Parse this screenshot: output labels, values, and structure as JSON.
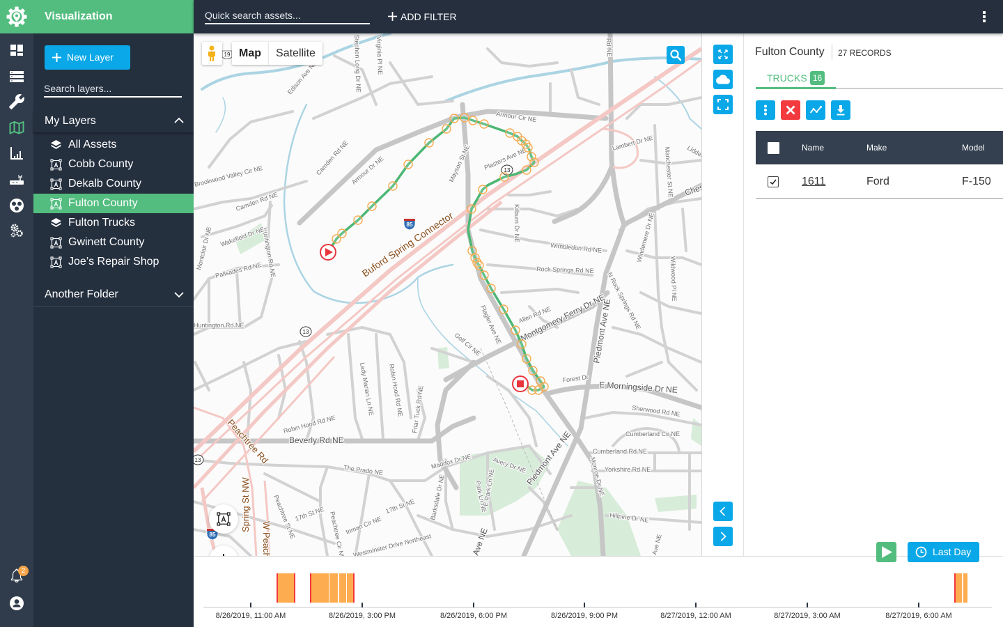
{
  "app": {
    "title": "Visualization",
    "colors": {
      "brand": "#53bd7f",
      "accent": "#0aa8e8",
      "danger": "#f33a3e",
      "sidebar": "#25303f",
      "rail": "#303c4c"
    }
  },
  "rail": {
    "items": [
      {
        "icon": "dashboard-icon"
      },
      {
        "icon": "storage-icon"
      },
      {
        "icon": "wrench-icon"
      },
      {
        "icon": "map-icon",
        "active": true
      },
      {
        "icon": "bar-chart-icon"
      },
      {
        "icon": "router-icon"
      },
      {
        "icon": "reel-icon"
      },
      {
        "icon": "gears-icon"
      }
    ],
    "notifications_count": "2",
    "bottom_icons": [
      "bell-icon",
      "user-icon"
    ]
  },
  "sidebar": {
    "new_layer_label": "New Layer",
    "search_placeholder": "Search layers...",
    "folders": [
      {
        "label": "My Layers",
        "expanded": true,
        "items": [
          {
            "label": "All Assets",
            "icon": "layers-icon"
          },
          {
            "label": "Cobb County",
            "icon": "shape-icon"
          },
          {
            "label": "Dekalb County",
            "icon": "shape-icon"
          },
          {
            "label": "Fulton County",
            "icon": "shape-icon",
            "selected": true
          },
          {
            "label": "Fulton Trucks",
            "icon": "layers-icon"
          },
          {
            "label": "Gwinett County",
            "icon": "shape-icon"
          },
          {
            "label": "Joe’s Repair Shop",
            "icon": "shape-icon"
          }
        ]
      },
      {
        "label": "Another Folder",
        "expanded": false
      }
    ]
  },
  "topbar": {
    "search_placeholder": "Quick search assets...",
    "add_filter_label": "ADD FILTER"
  },
  "map": {
    "type_control": {
      "options": [
        "Map",
        "Satellite"
      ],
      "selected": "Map"
    },
    "shields": [
      "19",
      "13",
      "13",
      "13",
      "85",
      "85"
    ],
    "labels": [
      "Armour Cir NE",
      "Armour Dr NE",
      "Camden Rd NE",
      "Plasters Ave NE",
      "Mayson St NE",
      "Kilburn Dr NE",
      "Buford Spring Connector",
      "Wimbledon Rd NE",
      "Rock Springs Rd NE",
      "Piedmont Ave NE",
      "N Rock Springs Rd NE",
      "Windemere Dr NE",
      "Wildwood Pl NE",
      "Allen Rd NE",
      "Montgomery Ferry Dr NE",
      "Flagler Ave NE",
      "Golf Cir NE",
      "Forest Dr",
      "E Morningside Dr NE",
      "Sherwood Rd NE",
      "Cumberland Cir NE",
      "Cumberland Rd NE",
      "Yorkshire Rd NE",
      "Monroe Dr NE",
      "Hillpine Dr NE",
      "Lady Marian Ln NE",
      "Robin Hood Rd NE",
      "Friar Tuck Rd NE",
      "Robin Hood Rd NE",
      "Beverly Rd NE",
      "The Prado NE",
      "Maddox Dr NE",
      "Avery Dr NE",
      "Barksdale Dr NE",
      "Park Ln NE",
      "E Park Ln NE",
      "17th St NE",
      "17th St NE",
      "Inman Cir NE",
      "Peachtree Cir NE",
      "Peachtree St NE",
      "Peachtree Rd",
      "Spring St NW",
      "W Peach",
      "Westminster Drive Northeast",
      "Huntington Rd NE",
      "Huntington Rd NE",
      "Palisades Rd NE",
      "Wakefield Dr NE",
      "Montclair Dr NE",
      "Camden Rd NE",
      "Brookwood Valley Cir NE",
      "Lambert Dr NE",
      "Manchester St NE",
      "Liddell",
      "Ches",
      "Edison Ave NE",
      "Stephen Long Dr NE",
      "Virginia Pl NE",
      "Rd NE",
      "Piedmont Ave NE",
      "Ave NE",
      "Ave NE"
    ],
    "route": {
      "line_color": "#4cb774",
      "point_color": "#f7a94f",
      "marker_color": "#e8363c",
      "start_marker": "play",
      "end_marker": "stop"
    }
  },
  "panel": {
    "title": "Fulton County",
    "record_count": "27 RECORDS",
    "tabs": [
      {
        "label": "TRUCKS",
        "count": "16",
        "active": true
      }
    ],
    "actions": [
      "more-icon",
      "delete-icon",
      "chart-icon",
      "download-icon"
    ],
    "table": {
      "header_checked": false,
      "columns": [
        "Name",
        "Make",
        "Model"
      ],
      "rows": [
        {
          "name": "1611",
          "make": "Ford",
          "model": "F-150",
          "checked": true
        }
      ]
    }
  },
  "playback": {
    "range_label": "Last Day"
  },
  "timeline": {
    "ticks": [
      "8/26/2019, 11:00 AM",
      "8/26/2019, 3:00 PM",
      "8/26/2019, 6:00 PM",
      "8/26/2019, 9:00 PM",
      "8/27/2019, 12:00 AM",
      "8/27/2019, 3:00 AM",
      "8/27/2019, 6:00 AM"
    ],
    "trips": [
      {
        "segments": [
          [
            "2019-08-26T12:42",
            "2019-08-26T13:12"
          ]
        ],
        "start_marker": true,
        "end_marker": true
      },
      {
        "segments": [
          [
            "2019-08-26T13:36",
            "2019-08-26T14:06"
          ],
          [
            "2019-08-26T14:07",
            "2019-08-26T14:21"
          ],
          [
            "2019-08-26T14:23",
            "2019-08-26T14:34"
          ],
          [
            "2019-08-26T14:35",
            "2019-08-26T14:48"
          ]
        ],
        "start_marker": true,
        "end_marker": true
      },
      {
        "segments": [
          [
            "2019-08-27T06:56",
            "2019-08-27T07:09"
          ],
          [
            "2019-08-27T07:11",
            "2019-08-27T07:18"
          ]
        ],
        "start_marker": true,
        "end_marker": false
      }
    ],
    "colors": {
      "activity": "#fdac4f",
      "marker": "#f2363c"
    }
  }
}
